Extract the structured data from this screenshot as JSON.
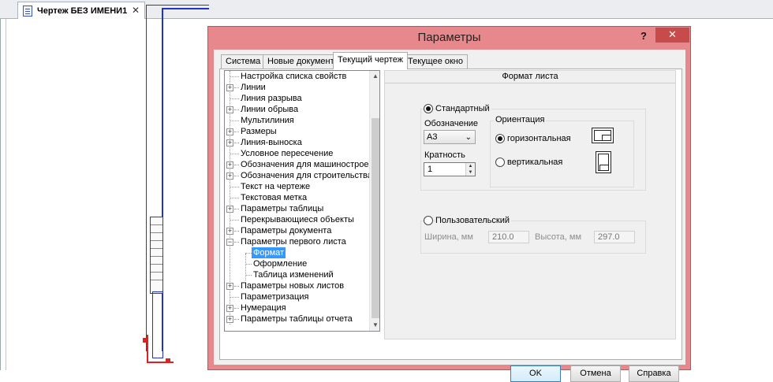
{
  "document": {
    "tab_title": "Чертеж БЕЗ ИМЕНИ1",
    "close_glyph": "✕"
  },
  "dialog": {
    "title": "Параметры",
    "help_glyph": "?",
    "close_glyph": "✕",
    "tabs": [
      {
        "label": "Система",
        "active": false
      },
      {
        "label": "Новые документы",
        "active": false
      },
      {
        "label": "Текущий чертеж",
        "active": true
      },
      {
        "label": "Текущее окно",
        "active": false
      }
    ],
    "tree": [
      {
        "label": "Настройка списка свойств",
        "expander": ""
      },
      {
        "label": "Линии",
        "expander": "+"
      },
      {
        "label": "Линия разрыва",
        "expander": ""
      },
      {
        "label": "Линии обрыва",
        "expander": "+"
      },
      {
        "label": "Мультилиния",
        "expander": ""
      },
      {
        "label": "Размеры",
        "expander": "+"
      },
      {
        "label": "Линия-выноска",
        "expander": "+"
      },
      {
        "label": "Условное пересечение",
        "expander": ""
      },
      {
        "label": "Обозначения для машиностроения",
        "expander": "+"
      },
      {
        "label": "Обозначения для строительства",
        "expander": "+"
      },
      {
        "label": "Текст на чертеже",
        "expander": ""
      },
      {
        "label": "Текстовая метка",
        "expander": ""
      },
      {
        "label": "Параметры таблицы",
        "expander": "+"
      },
      {
        "label": "Перекрывающиеся объекты",
        "expander": ""
      },
      {
        "label": "Параметры документа",
        "expander": "+"
      },
      {
        "label": "Параметры первого листа",
        "expander": "−"
      },
      {
        "label": "Формат",
        "expander": "",
        "child": true,
        "selected": true
      },
      {
        "label": "Оформление",
        "expander": "",
        "child": true
      },
      {
        "label": "Таблица изменений",
        "expander": "",
        "child": true
      },
      {
        "label": "Параметры новых листов",
        "expander": "+"
      },
      {
        "label": "Параметризация",
        "expander": ""
      },
      {
        "label": "Нумерация",
        "expander": "+"
      },
      {
        "label": "Параметры таблицы отчета",
        "expander": "+"
      }
    ],
    "panel": {
      "header": "Формат листа",
      "standard": {
        "label": "Стандартный",
        "selected": true,
        "designation_label": "Обозначение",
        "designation_value": "А3",
        "multiplicity_label": "Кратность",
        "multiplicity_value": "1",
        "orientation": {
          "label": "Ориентация",
          "horizontal_label": "горизонтальная",
          "vertical_label": "вертикальная",
          "selected": "horizontal",
          "horizontal_icon": "landscape-sheet-icon",
          "vertical_icon": "portrait-sheet-icon"
        }
      },
      "custom": {
        "label": "Пользовательский",
        "selected": false,
        "width_label": "Ширина, мм",
        "width_value": "210.0",
        "height_label": "Высота, мм",
        "height_value": "297.0"
      }
    },
    "buttons": {
      "ok": "OK",
      "cancel": "Отмена",
      "help": "Справка"
    },
    "colors": {
      "titlebar": "#e7898c",
      "close": "#c84b4b",
      "selection": "#3399ff"
    }
  }
}
